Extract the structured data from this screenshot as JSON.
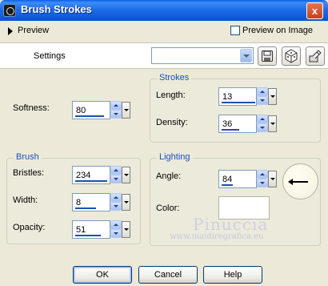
{
  "window": {
    "title": "Brush Strokes",
    "close_glyph": "x"
  },
  "preview": {
    "label": "Preview",
    "checkbox_label": "Preview on Image",
    "checked": false
  },
  "settings": {
    "label": "Settings",
    "preset_value": "",
    "buttons": [
      "save-preset-icon",
      "randomize-dice-icon",
      "reset-icon"
    ]
  },
  "softness": {
    "label": "Softness:",
    "value": "80"
  },
  "strokes": {
    "title": "Strokes",
    "length": {
      "label": "Length:",
      "value": "13"
    },
    "density": {
      "label": "Density:",
      "value": "36"
    }
  },
  "brush": {
    "title": "Brush",
    "bristles": {
      "label": "Bristles:",
      "value": "234"
    },
    "width": {
      "label": "Width:",
      "value": "8"
    },
    "opacity": {
      "label": "Opacity:",
      "value": "51"
    }
  },
  "lighting": {
    "title": "Lighting",
    "angle": {
      "label": "Angle:",
      "value": "84"
    },
    "color": {
      "label": "Color:",
      "value": "#ffffff"
    }
  },
  "watermark": {
    "name": "Pinuccia",
    "url": "www.maidiregrafica.eu"
  },
  "footer": {
    "ok_label": "OK",
    "cancel_label": "Cancel",
    "help_label": "Help"
  },
  "colors": {
    "title_bar": "#0c56d6",
    "legend": "#1750c4",
    "face": "#ece9d8"
  }
}
